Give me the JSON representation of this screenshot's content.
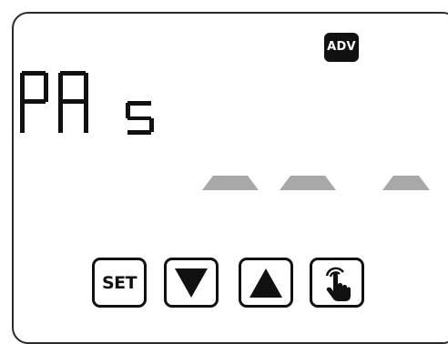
{
  "display": {
    "text": "PA 5",
    "segment_color": "#111111"
  },
  "badges": {
    "adv_label": "ADV"
  },
  "indicators": {
    "dash_color": "#a8a8a8",
    "count": 3
  },
  "buttons": {
    "set_label": "SET",
    "down_icon": "triangle-down-icon",
    "up_icon": "triangle-up-icon",
    "touch_icon": "hand-pointer-icon"
  },
  "colors": {
    "border": "#2a2a2a",
    "ink": "#111111",
    "background": "#ffffff"
  }
}
